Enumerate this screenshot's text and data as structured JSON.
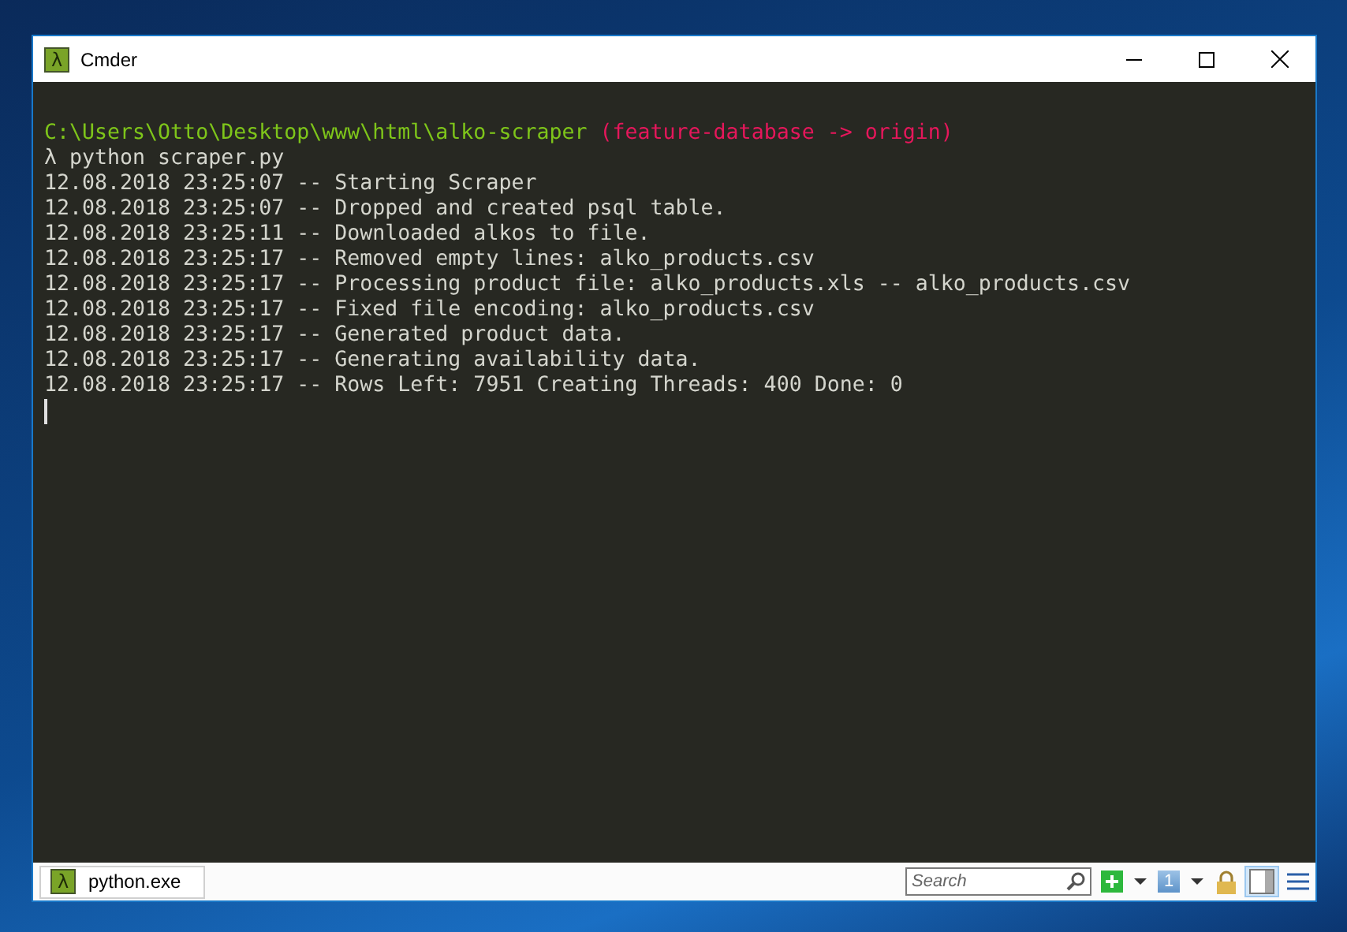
{
  "window": {
    "title": "Cmder",
    "app_icon_glyph": "λ"
  },
  "terminal": {
    "prompt": {
      "path": "C:\\Users\\Otto\\Desktop\\www\\html\\alko-scraper",
      "branch": "(feature-database -> origin)"
    },
    "command": {
      "symbol": "λ",
      "text": "python scraper.py"
    },
    "log_lines": [
      "12.08.2018 23:25:07 -- Starting Scraper",
      "12.08.2018 23:25:07 -- Dropped and created psql table.",
      "12.08.2018 23:25:11 -- Downloaded alkos to file.",
      "12.08.2018 23:25:17 -- Removed empty lines: alko_products.csv",
      "12.08.2018 23:25:17 -- Processing product file: alko_products.xls -- alko_products.csv",
      "12.08.2018 23:25:17 -- Fixed file encoding: alko_products.csv",
      "12.08.2018 23:25:17 -- Generated product data.",
      "12.08.2018 23:25:17 -- Generating availability data.",
      "12.08.2018 23:25:17 -- Rows Left: 7951 Creating Threads: 400 Done: 0"
    ],
    "cursor": true
  },
  "status_bar": {
    "tabs": [
      {
        "icon_glyph": "λ",
        "label": "python.exe",
        "selected": true
      }
    ],
    "search": {
      "placeholder": "Search"
    },
    "console_number": "1",
    "split_view": true
  }
}
